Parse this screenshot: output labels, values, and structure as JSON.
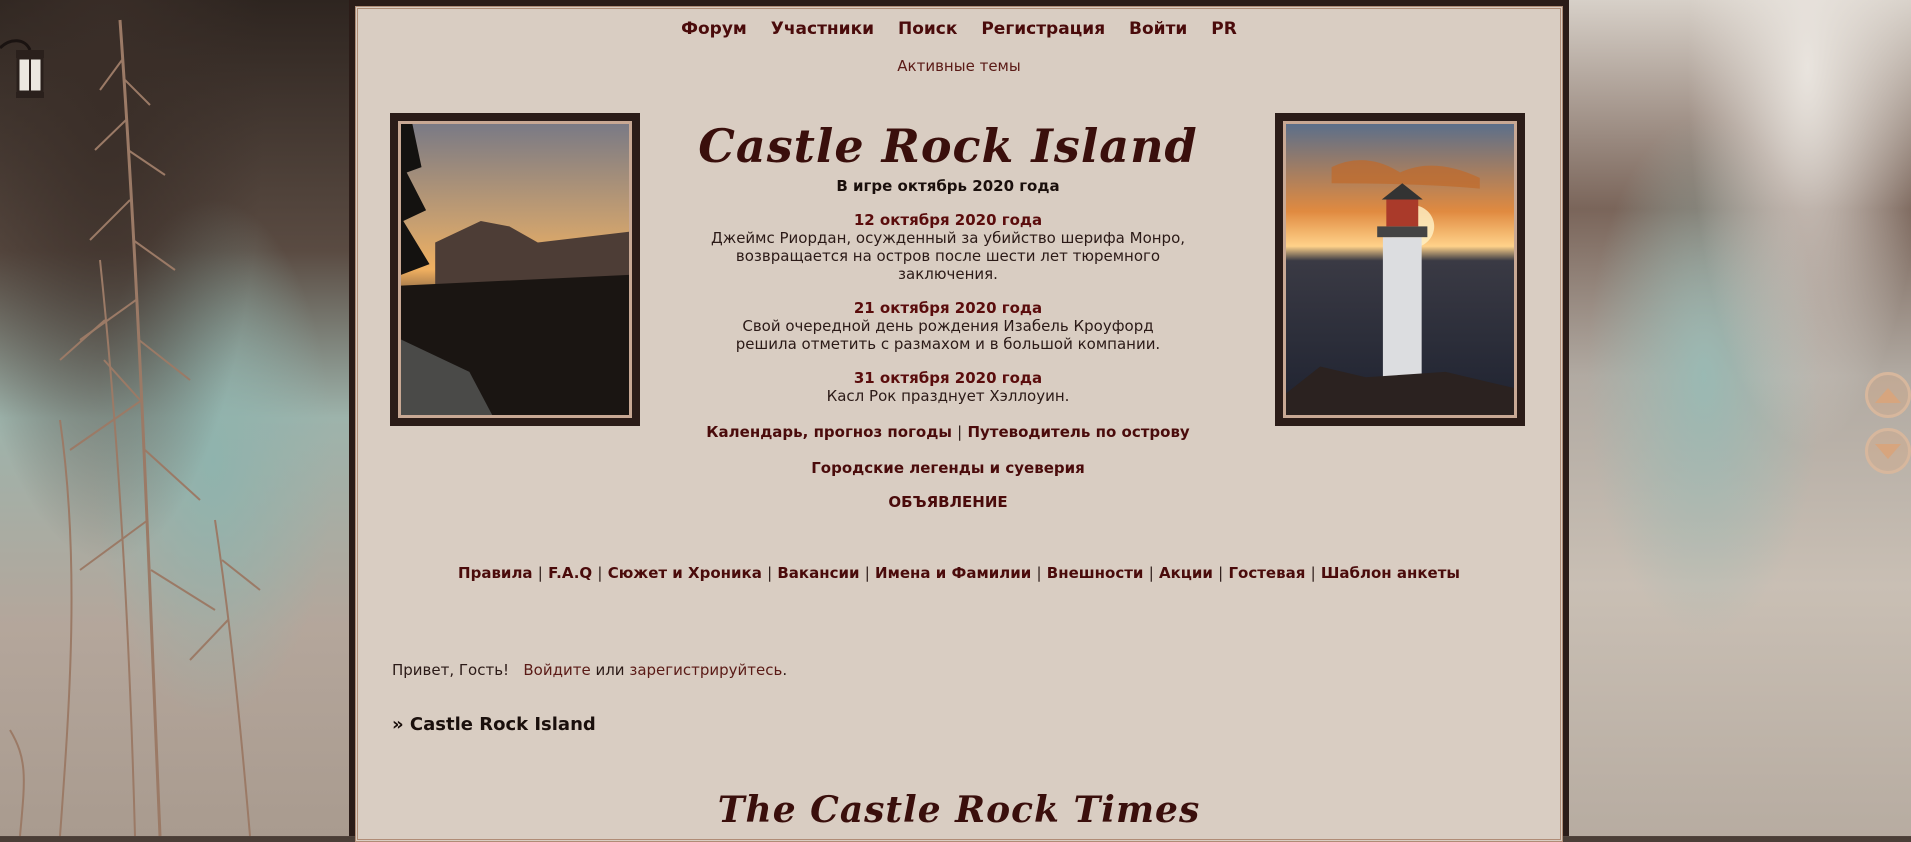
{
  "nav": {
    "items": [
      "Форум",
      "Участники",
      "Поиск",
      "Регистрация",
      "Войти",
      "PR"
    ],
    "active_topics": "Активные темы"
  },
  "header": {
    "logo": "Castle Rock Island",
    "ingame": "В игре октябрь 2020 года",
    "events": [
      {
        "date": "12 октября 2020 года",
        "text": "Джеймс Риордан, осужденный за убийство шерифа Монро, возвращается на остров после шести лет тюремного заключения."
      },
      {
        "date": "21 октября 2020 года",
        "text": "Свой очередной день рождения Изабель Кроуфорд решила отметить с размахом и в большой компании."
      },
      {
        "date": "31 октября 2020 года",
        "text": "Касл Рок празднует Хэллоуин."
      }
    ],
    "links": [
      "Календарь, прогноз погоды",
      "Путеводитель по острову"
    ],
    "legends": "Городские легенды и суеверия",
    "announce": "ОБЪЯВЛЕНИЕ"
  },
  "rules_links": [
    "Правила",
    "F.A.Q",
    "Сюжет и Хроника",
    "Вакансии",
    "Имена и Фамилии",
    "Внешности",
    "Акции",
    "Гостевая",
    "Шаблон анкеты"
  ],
  "greeting": {
    "prefix": "Привет, Гость!",
    "login": "Войдите",
    "or": "или",
    "register": "зарегистрируйтесь",
    "dot": "."
  },
  "breadcrumb": "» Castle Rock Island",
  "times_title": "The Castle Rock Times"
}
